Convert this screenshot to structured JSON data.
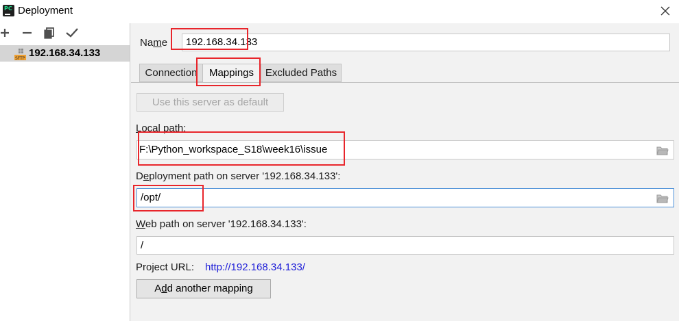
{
  "window": {
    "title": "Deployment",
    "icon": "pycharm-app-icon",
    "close_icon": "close-icon"
  },
  "toolbar": {
    "add_icon": "plus-icon",
    "remove_icon": "minus-icon",
    "copy_icon": "copy-icon",
    "default_icon": "checkmark-icon"
  },
  "servers": [
    {
      "name": "192.168.34.133",
      "type_icon": "sftp-icon",
      "selected": true
    }
  ],
  "form": {
    "name_label_prefix": "Na",
    "name_label_mnemonic": "m",
    "name_label_suffix": "e",
    "name_value": "192.168.34.133",
    "tabs": [
      {
        "label": "Connection",
        "active": false
      },
      {
        "label": "Mappings",
        "active": true
      },
      {
        "label": "Excluded Paths",
        "active": false
      }
    ],
    "use_default_button": "Use this server as default",
    "local_path_label_mnemonic": "L",
    "local_path_label_rest": "ocal path:",
    "local_path_value": "F:\\Python_workspace_S18\\week16\\issue",
    "deployment_path_label_prefix": "D",
    "deployment_path_label_mnemonic": "e",
    "deployment_path_label_rest": "ployment path on server '192.168.34.133':",
    "deployment_path_value": "/opt/",
    "web_path_label_mnemonic": "W",
    "web_path_label_rest": "eb path on server '192.168.34.133':",
    "web_path_value": "/",
    "project_url_label": "Project URL:",
    "project_url_value": "http://192.168.34.133/",
    "add_mapping_prefix": "A",
    "add_mapping_mnemonic": "d",
    "add_mapping_rest": "d another mapping",
    "folder_icon": "folder-icon"
  },
  "colors": {
    "annotation_red": "#e8252b",
    "link_blue": "#2020d8",
    "focus_blue": "#4a8fd8",
    "selection_gray": "#d5d5d5"
  }
}
